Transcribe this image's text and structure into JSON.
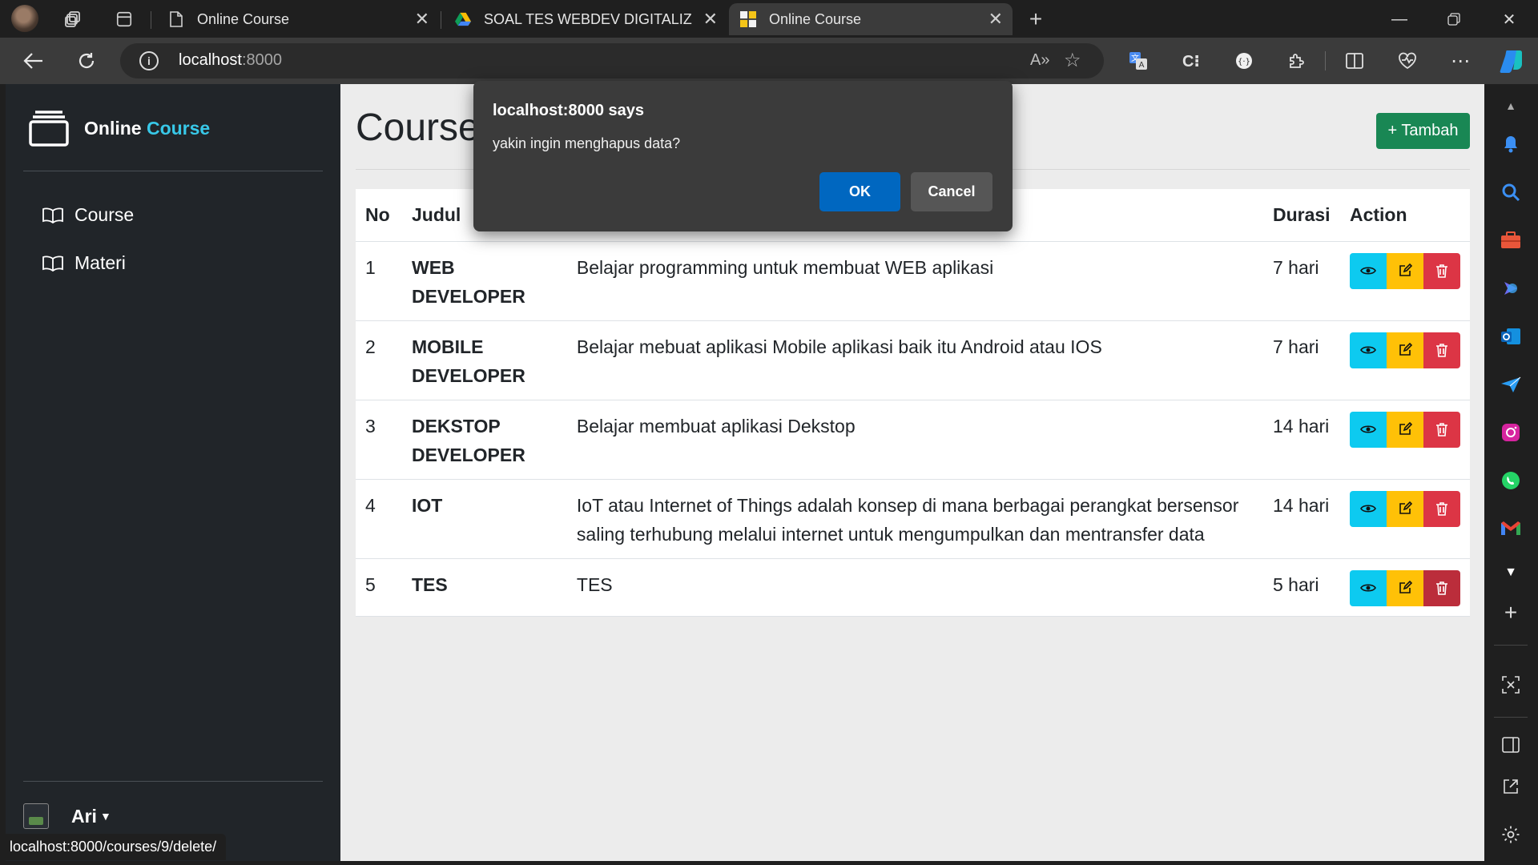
{
  "browser": {
    "tabs": [
      {
        "title": "Online Course"
      },
      {
        "title": "SOAL TES WEBDEV DIGITALIZ BA"
      },
      {
        "title": "Online Course"
      }
    ],
    "url_host": "localhost",
    "url_port": ":8000",
    "status_url": "localhost:8000/courses/9/delete/"
  },
  "sidebar": {
    "brand_prefix": "Online",
    "brand_accent": "Course",
    "items": [
      {
        "label": "Course"
      },
      {
        "label": "Materi"
      }
    ],
    "user_name": "Ari"
  },
  "main": {
    "title": "Course",
    "add_button": "+ Tambah",
    "headers": {
      "no": "No",
      "judul": "Judul",
      "deskripsi": "",
      "durasi": "Durasi",
      "action": "Action"
    },
    "rows": [
      {
        "no": "1",
        "judul": "WEB DEVELOPER",
        "deskripsi": "Belajar programming untuk membuat WEB aplikasi",
        "durasi": "7 hari"
      },
      {
        "no": "2",
        "judul": "MOBILE DEVELOPER",
        "deskripsi": "Belajar mebuat aplikasi Mobile aplikasi baik itu Android atau IOS",
        "durasi": "7 hari"
      },
      {
        "no": "3",
        "judul": "DEKSTOP DEVELOPER",
        "deskripsi": "Belajar membuat aplikasi Dekstop",
        "durasi": "14 hari"
      },
      {
        "no": "4",
        "judul": "IOT",
        "deskripsi": "IoT atau Internet of Things adalah konsep di mana berbagai perangkat bersensor saling terhubung melalui internet untuk mengumpulkan dan mentransfer data",
        "durasi": "14 hari"
      },
      {
        "no": "5",
        "judul": "TES",
        "deskripsi": "TES",
        "durasi": "5 hari"
      }
    ]
  },
  "dialog": {
    "title": "localhost:8000 says",
    "message": "yakin ingin menghapus data?",
    "ok": "OK",
    "cancel": "Cancel"
  },
  "colors": {
    "accent": "#38c8e8",
    "add_button": "#198754",
    "view": "#0dcaf0",
    "edit": "#ffc107",
    "delete": "#dc3545",
    "dialog_ok": "#0067c0"
  }
}
